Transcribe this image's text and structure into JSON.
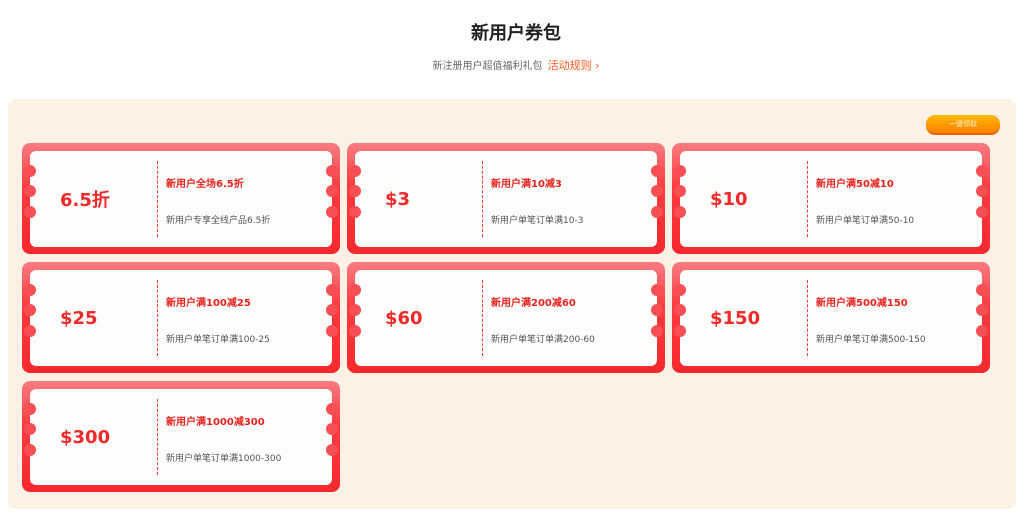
{
  "header": {
    "title": "新用户券包",
    "subtitle": "新注册用户超值福利礼包",
    "rules_link": "活动规则",
    "rules_chevron": "›"
  },
  "claim_all_button": "一键领取",
  "coupons": [
    {
      "value": "6.5折",
      "title": "新用户全场6.5折",
      "desc": "新用户专享全线产品6.5折"
    },
    {
      "value": "$3",
      "title": "新用户满10减3",
      "desc": "新用户单笔订单满10-3"
    },
    {
      "value": "$10",
      "title": "新用户满50减10",
      "desc": "新用户单笔订单满50-10"
    },
    {
      "value": "$25",
      "title": "新用户满100减25",
      "desc": "新用户单笔订单满100-25"
    },
    {
      "value": "$60",
      "title": "新用户满200减60",
      "desc": "新用户单笔订单满200-60"
    },
    {
      "value": "$150",
      "title": "新用户满500减150",
      "desc": "新用户单笔订单满500-150"
    },
    {
      "value": "$300",
      "title": "新用户满1000减300",
      "desc": "新用户单笔订单满1000-300"
    }
  ],
  "colors": {
    "accent": "#ff5a1f",
    "coupon_red": "#f7282d",
    "panel_bg": "#fdf1e5",
    "button_gold": "#ffb800"
  }
}
